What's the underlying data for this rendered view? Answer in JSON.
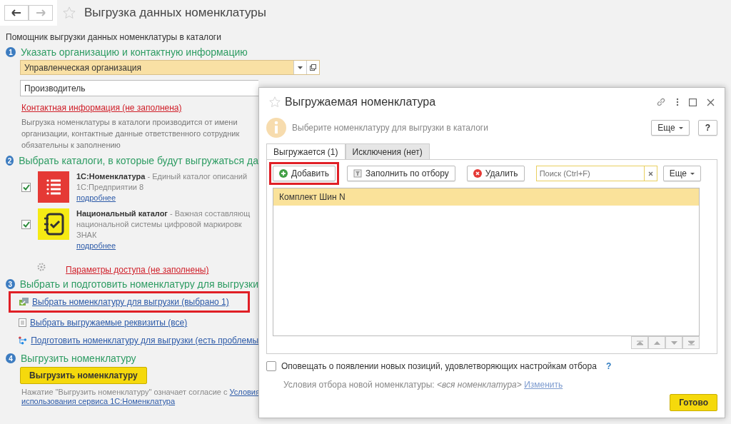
{
  "page": {
    "title": "Выгрузка данных номенклатуры",
    "favorite": false,
    "subtitle": "Помощник выгрузки данных номенклатуры в каталоги"
  },
  "steps": [
    {
      "number": "1",
      "title": "Указать организацию и контактную информацию"
    },
    {
      "number": "2",
      "title": "Выбрать каталоги, в которые будут выгружаться да"
    },
    {
      "number": "3",
      "title": "Выбрать и подготовить номенклатуру для выгрузки"
    },
    {
      "number": "4",
      "title": "Выгрузить номенклатуру"
    }
  ],
  "organization_field": {
    "value": "Управленческая организация"
  },
  "role_field": {
    "value": "Производитель"
  },
  "contact_link": "Контактная информация (не заполнена)",
  "contact_note": [
    "Выгрузка номенклатуры в каталоги производится от имени",
    "организации, контактные данные ответственного сотрудник",
    "обязательны к заполнению"
  ],
  "catalogs": [
    {
      "kind": "list",
      "checked": true,
      "name": "1С:Номенклатура",
      "description": " - Единый каталог описаний",
      "lines": [
        "1С:Предприятии 8"
      ],
      "link": "подробнее"
    },
    {
      "kind": "notebook",
      "checked": true,
      "name": "Национальный каталог",
      "description": " - Важная составляющ",
      "lines": [
        "национальной системы цифровой маркировк",
        "ЗНАК"
      ],
      "link": "подробнее"
    }
  ],
  "access_link": "Параметры доступа (не заполнены)",
  "step3_links": [
    {
      "kind": "goods",
      "text": "Выбрать номенклатуру для выгрузки (выбрано 1)",
      "highlighted": true
    },
    {
      "kind": "list",
      "text": "Выбрать выгружаемые реквизиты (все)",
      "highlighted": false
    },
    {
      "kind": "tree",
      "text": "Подготовить номенклатуру для выгрузки (есть проблемы",
      "highlighted": false
    }
  ],
  "export_button": "Выгрузить номенклатуру",
  "agreement": {
    "text": "Нажатие \"Выгрузить номенклатуру\" означает согласие с ",
    "link1": "Условия",
    "link2": "использования сервиса 1С:Номенклатура"
  },
  "dialog": {
    "title": "Выгружаемая номенклатура",
    "favorite": false,
    "info": "Выберите номенклатуру для выгрузки в каталоги",
    "more_button": "Еще",
    "help_button": "?",
    "tabs": [
      {
        "label": "Выгружается (1)",
        "selected": true
      },
      {
        "label": "Исключения (нет)",
        "selected": false
      }
    ],
    "toolbar": [
      {
        "kind": "add",
        "label": "Добавить",
        "highlighted": true
      },
      {
        "kind": "fill",
        "label": "Заполнить по отбору",
        "highlighted": false
      },
      {
        "kind": "delete",
        "label": "Удалить",
        "highlighted": false
      }
    ],
    "search": {
      "placeholder": "Поиск (Ctrl+F)"
    },
    "table_more_button": "Еще",
    "rows": [
      {
        "name": "Комплект Шин N",
        "selected": true
      }
    ],
    "notify": {
      "label": "Оповещать о появлении новых позиций, удовлетворяющих настройкам отбора",
      "checked": false,
      "help": "?"
    },
    "condition": {
      "label": "Условия отбора новой номенклатуры: ",
      "value": "<вся номенклатура>",
      "link": "Изменить"
    },
    "done_button": "Готово"
  }
}
